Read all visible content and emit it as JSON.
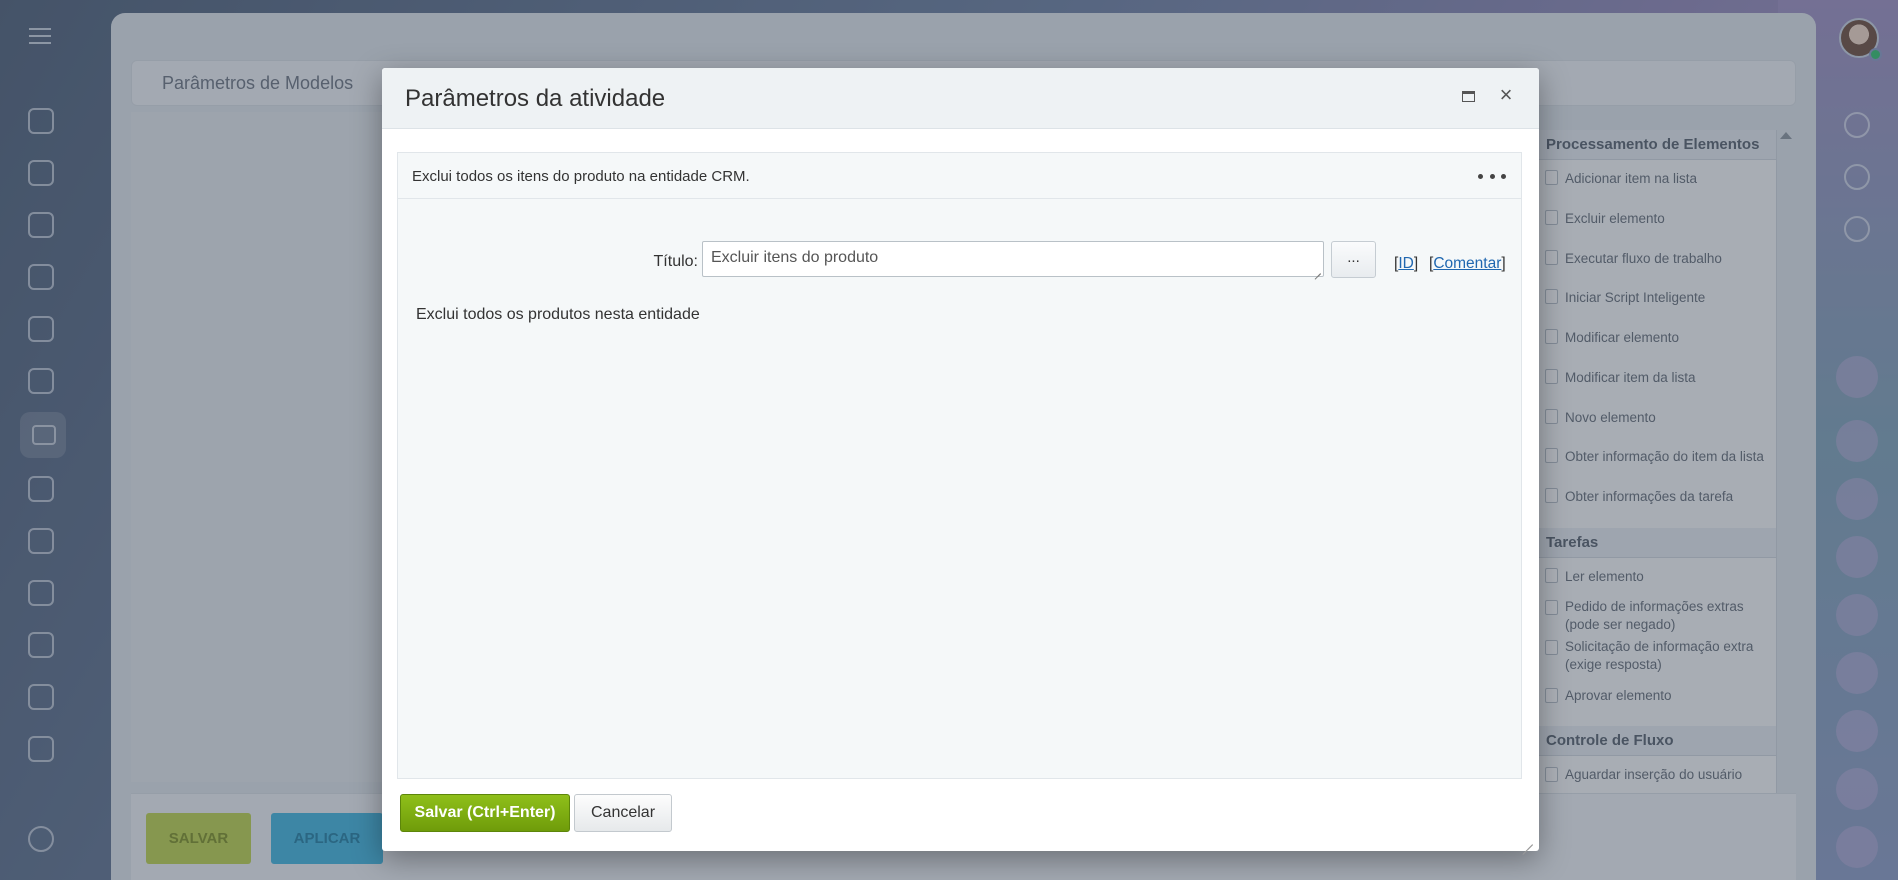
{
  "background": {
    "breadcrumb": "Parâmetros de Modelos",
    "bottom_bar": {
      "save_label": "SALVAR",
      "apply_label": "APLICAR"
    },
    "elements_panel": {
      "groups": [
        {
          "title": "Processamento de Elementos",
          "items": [
            "Adicionar item na lista",
            "Excluir elemento",
            "Executar fluxo de trabalho",
            "Iniciar Script Inteligente",
            "Modificar elemento",
            "Modificar item da lista",
            "Novo elemento",
            "Obter informação do item da lista",
            "Obter informações da tarefa"
          ]
        },
        {
          "title": "Tarefas",
          "items": [
            "Ler elemento",
            "Pedido de informações extras (pode ser negado)",
            "Solicitação de informação extra (exige resposta)",
            "Aprovar elemento"
          ]
        },
        {
          "title": "Controle de Fluxo",
          "items": [
            "Aguardar inserção do usuário"
          ]
        }
      ]
    }
  },
  "modal": {
    "title": "Parâmetros da atividade",
    "description": "Exclui todos os itens do produto na entidade CRM.",
    "field_label": "Título:",
    "title_value": "Excluir itens do produto",
    "dots_label": "...",
    "id_link": "ID",
    "comment_link": "Comentar",
    "hint": "Exclui todos os produtos nesta entidade",
    "save_label": "Salvar (Ctrl+Enter)",
    "cancel_label": "Cancelar"
  },
  "colors": {
    "accent_green": "#7aaa0f",
    "link_blue": "#2067b0"
  }
}
